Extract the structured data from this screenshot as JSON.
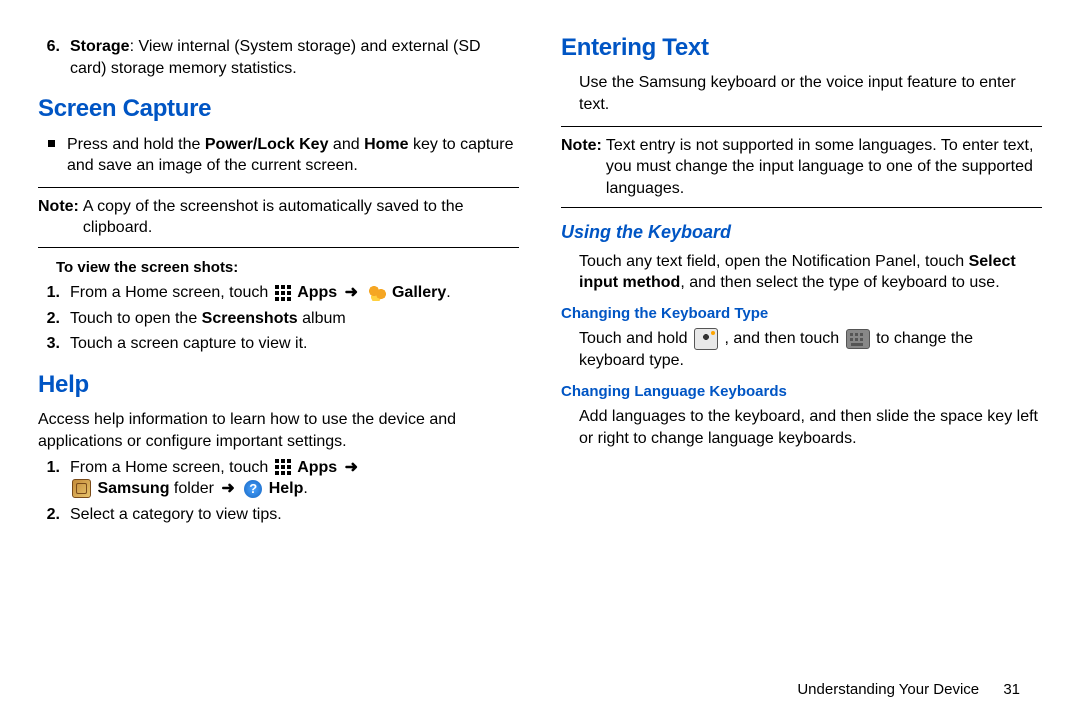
{
  "left": {
    "storage": {
      "num": "6.",
      "label": "Storage",
      "text": ": View internal (System storage) and external (SD card) storage memory statistics."
    },
    "screen_capture": {
      "heading": "Screen Capture",
      "bullet_pre": "Press and hold the ",
      "bullet_bold1": "Power/Lock Key",
      "bullet_mid": " and ",
      "bullet_bold2": "Home",
      "bullet_post": " key to capture and save an image of the current screen.",
      "note_label": "Note:",
      "note_text": " A copy of the screenshot is automatically saved to the clipboard.",
      "subhead": "To view the screen shots:",
      "steps": {
        "n1": "1.",
        "s1_pre": "From a Home screen, touch ",
        "s1_apps": "Apps",
        "s1_gallery": "Gallery",
        "n2": "2.",
        "s2_pre": "Touch to open the ",
        "s2_bold": "Screenshots",
        "s2_post": " album",
        "n3": "3.",
        "s3": "Touch a screen capture to view it."
      }
    },
    "help": {
      "heading": "Help",
      "intro": "Access help information to learn how to use the device and applications or configure important settings.",
      "n1": "1.",
      "s1_pre": "From a Home screen, touch ",
      "s1_apps": "Apps",
      "s1_samsung": "Samsung",
      "s1_folder": " folder ",
      "s1_help": "Help",
      "n2": "2.",
      "s2": "Select a category to view tips."
    }
  },
  "right": {
    "entering_text": {
      "heading": "Entering Text",
      "intro": "Use the Samsung keyboard or the voice input feature to enter text.",
      "note_label": "Note:",
      "note_text": " Text entry is not supported in some languages. To enter text, you must change the input language to one of the supported languages."
    },
    "using_kb": {
      "heading": "Using the Keyboard",
      "p_pre": "Touch any text field, open the Notification Panel, touch ",
      "p_bold": "Select input method",
      "p_post": ", and then select the type of keyboard to use."
    },
    "change_type": {
      "heading": "Changing the Keyboard Type",
      "pre": "Touch and hold ",
      "mid": ", and then touch ",
      "post": " to change the keyboard type."
    },
    "change_lang": {
      "heading": "Changing Language Keyboards",
      "text": "Add languages to the keyboard, and then slide the space key left or right to change language keyboards."
    }
  },
  "footer": {
    "section": "Understanding Your Device",
    "page": "31"
  },
  "glyphs": {
    "arrow": "➜",
    "help_q": "?"
  }
}
